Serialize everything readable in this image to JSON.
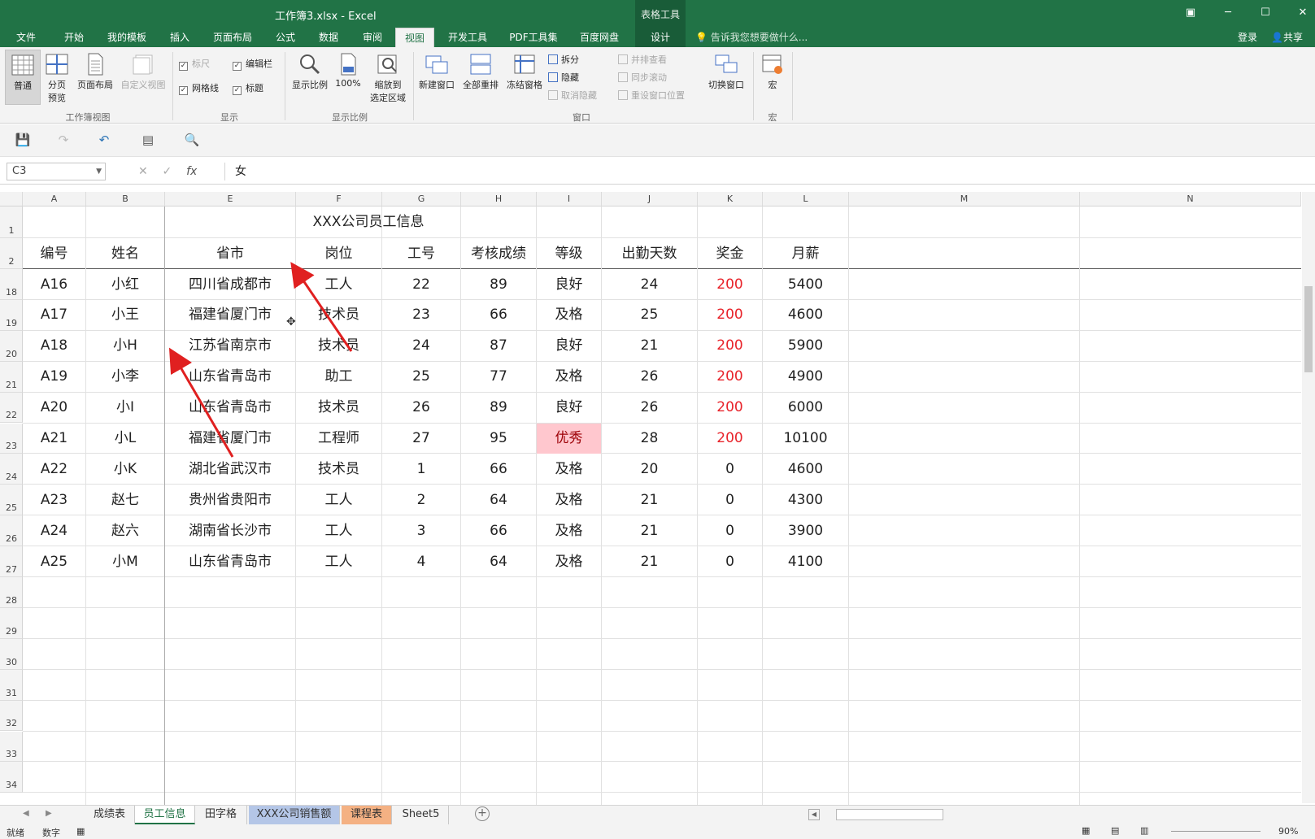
{
  "app": {
    "title": "工作簿3.xlsx - Excel",
    "context_tool_label": "表格工具",
    "window_buttons": {
      "ribbon_display": "▣",
      "minimize": "─",
      "maximize": "☐",
      "close": "✕"
    }
  },
  "tabs": [
    "文件",
    "开始",
    "我的模板",
    "插入",
    "页面布局",
    "公式",
    "数据",
    "审阅",
    "视图",
    "开发工具",
    "PDF工具集",
    "百度网盘",
    "设计"
  ],
  "active_tab": "视图",
  "tell_me": "告诉我您想要做什么...",
  "login": "登录",
  "share": "共享",
  "ribbon": {
    "workbook_views": {
      "label": "工作簿视图",
      "normal": "普通",
      "page_break_1": "分页",
      "page_break_2": "预览",
      "page_layout": "页面布局",
      "custom_views": "自定义视图"
    },
    "show": {
      "label": "显示",
      "ruler": "标尺",
      "formula_bar": "编辑栏",
      "gridlines": "网格线",
      "headings": "标题"
    },
    "zoom": {
      "label": "显示比例",
      "zoom": "显示比例",
      "hundred": "100%",
      "zoom_sel_1": "缩放到",
      "zoom_sel_2": "选定区域"
    },
    "window": {
      "label": "窗口",
      "new_window": "新建窗口",
      "arrange_all": "全部重排",
      "freeze_panes": "冻结窗格",
      "split": "拆分",
      "hide": "隐藏",
      "unhide": "取消隐藏",
      "side_by_side": "并排查看",
      "sync_scroll": "同步滚动",
      "reset_position": "重设窗口位置",
      "switch_windows": "切换窗口"
    },
    "macros": {
      "label": "宏",
      "macros": "宏"
    }
  },
  "formula_bar": {
    "name_box": "C3",
    "fx_label": "fx",
    "value": "女"
  },
  "columns": [
    "A",
    "B",
    "E",
    "F",
    "G",
    "H",
    "I",
    "J",
    "K",
    "L",
    "M",
    "N"
  ],
  "header_row": {
    "number": "1",
    "title": "XXX公司员工信息"
  },
  "column_titles_row": {
    "number": "2",
    "cells": [
      "编号",
      "姓名",
      "省市",
      "岗位",
      "工号",
      "考核成绩",
      "等级",
      "出勤天数",
      "奖金",
      "月薪"
    ]
  },
  "rows": [
    {
      "n": "18",
      "cells": [
        "A16",
        "小红",
        "四川省成都市",
        "工人",
        "22",
        "89",
        "良好",
        "24",
        "200",
        "5400"
      ]
    },
    {
      "n": "19",
      "cells": [
        "A17",
        "小王",
        "福建省厦门市",
        "技术员",
        "23",
        "66",
        "及格",
        "25",
        "200",
        "4600"
      ]
    },
    {
      "n": "20",
      "cells": [
        "A18",
        "小H",
        "江苏省南京市",
        "技术员",
        "24",
        "87",
        "良好",
        "21",
        "200",
        "5900"
      ]
    },
    {
      "n": "21",
      "cells": [
        "A19",
        "小李",
        "山东省青岛市",
        "助工",
        "25",
        "77",
        "及格",
        "26",
        "200",
        "4900"
      ]
    },
    {
      "n": "22",
      "cells": [
        "A20",
        "小I",
        "山东省青岛市",
        "技术员",
        "26",
        "89",
        "良好",
        "26",
        "200",
        "6000"
      ]
    },
    {
      "n": "23",
      "cells": [
        "A21",
        "小L",
        "福建省厦门市",
        "工程师",
        "27",
        "95",
        "优秀",
        "28",
        "200",
        "10100"
      ]
    },
    {
      "n": "24",
      "cells": [
        "A22",
        "小K",
        "湖北省武汉市",
        "技术员",
        "1",
        "66",
        "及格",
        "20",
        "0",
        "4600"
      ]
    },
    {
      "n": "25",
      "cells": [
        "A23",
        "赵七",
        "贵州省贵阳市",
        "工人",
        "2",
        "64",
        "及格",
        "21",
        "0",
        "4300"
      ]
    },
    {
      "n": "26",
      "cells": [
        "A24",
        "赵六",
        "湖南省长沙市",
        "工人",
        "3",
        "66",
        "及格",
        "21",
        "0",
        "3900"
      ]
    },
    {
      "n": "27",
      "cells": [
        "A25",
        "小M",
        "山东省青岛市",
        "工人",
        "4",
        "64",
        "及格",
        "21",
        "0",
        "4100"
      ]
    }
  ],
  "empty_rows": [
    "28",
    "29",
    "30",
    "31",
    "32",
    "33",
    "34"
  ],
  "highlight_value": "优秀",
  "colors": {
    "accent": "#217346",
    "bonus_red": "#e8232a",
    "highlight_fill": "#ffc7ce",
    "arrow": "#e02020"
  },
  "sheet_tabs": [
    "成绩表",
    "员工信息",
    "田字格",
    "XXX公司销售额",
    "课程表",
    "Sheet5"
  ],
  "active_sheet": "员工信息",
  "status": {
    "ready": "就绪",
    "mode": "数字",
    "zoom": "90%"
  }
}
